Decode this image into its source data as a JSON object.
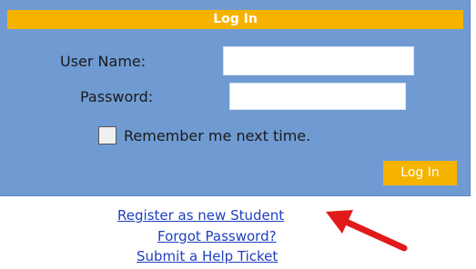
{
  "login": {
    "title": "Log In",
    "username_label": "User Name:",
    "username_value": "",
    "password_label": "Password:",
    "password_value": "",
    "remember_label": "Remember me next time.",
    "remember_checked": false,
    "submit_label": "Log In"
  },
  "links": {
    "register": "Register as new Student",
    "forgot": "Forgot Password?",
    "ticket": "Submit a Help Ticket"
  },
  "colors": {
    "panel": "#6f9bd2",
    "accent": "#f5b300",
    "link": "#1f3fbf",
    "annotation_arrow": "#e11a1a"
  },
  "annotation": {
    "icon": "red-arrow-icon"
  }
}
